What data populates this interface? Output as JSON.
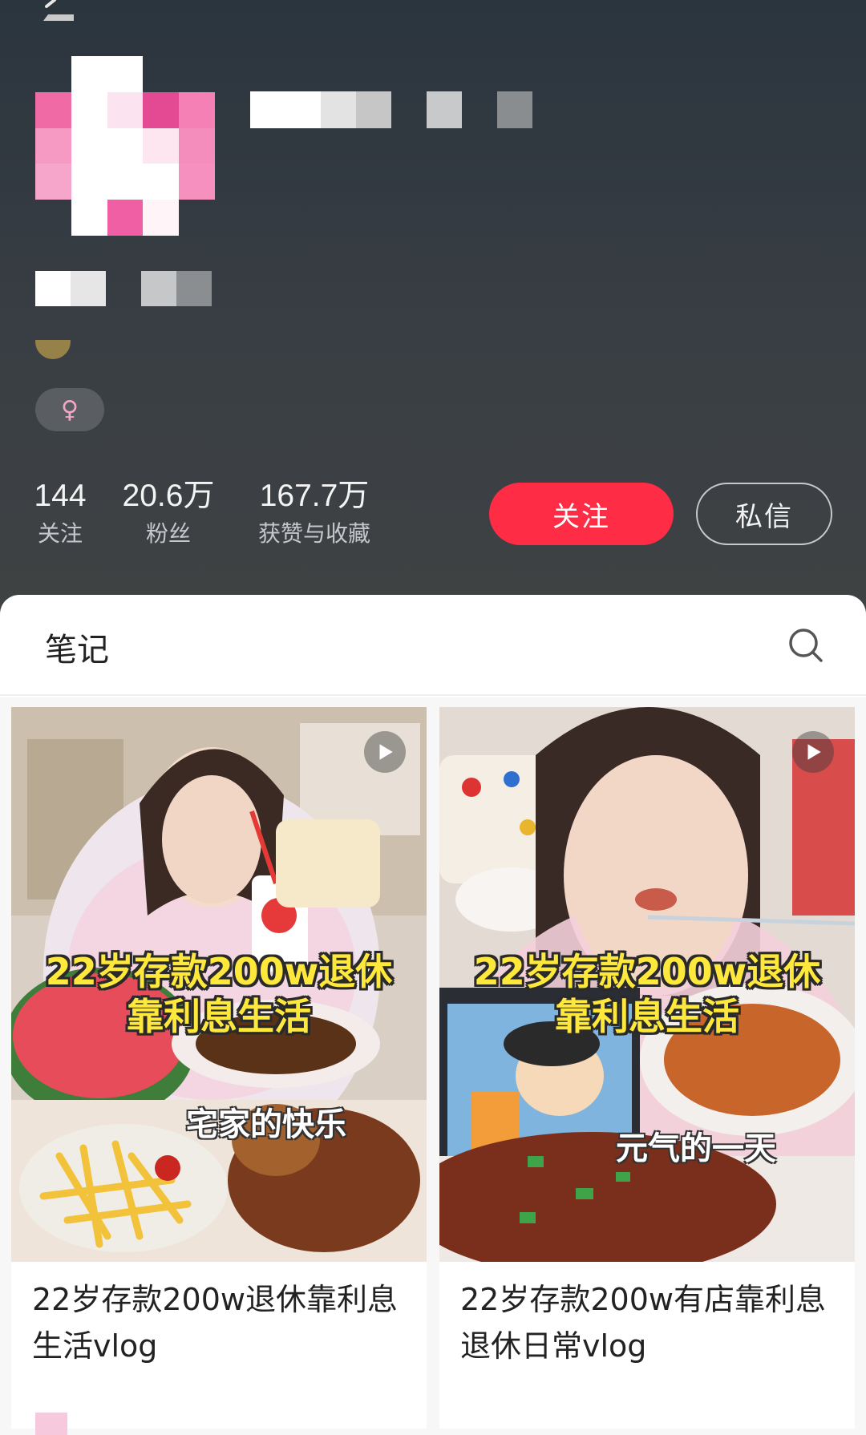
{
  "app": {
    "accent_color": "#fe2c45",
    "header_color": "#34393e",
    "back_icon": "back-chevron-icon"
  },
  "profile": {
    "gender_symbol": "♀",
    "stats": [
      {
        "value": "144",
        "label": "关注"
      },
      {
        "value": "20.6万",
        "label": "粉丝"
      },
      {
        "value": "167.7万",
        "label": "获赞与收藏"
      }
    ],
    "follow_label": "关注",
    "message_label": "私信"
  },
  "tabs": {
    "notes_label": "笔记",
    "search_icon": "search-icon"
  },
  "notes": [
    {
      "cover_title_line1": "22岁存款200w退休",
      "cover_title_line2": "靠利息生活",
      "cover_subtitle": "宅家的快乐",
      "title": "22岁存款200w退休靠利息生活vlog",
      "type_icon": "play-icon"
    },
    {
      "cover_title_line1": "22岁存款200w退休",
      "cover_title_line2": "靠利息生活",
      "cover_subtitle": "元气的一天",
      "title": "22岁存款200w有店靠利息退休日常vlog",
      "type_icon": "play-icon"
    }
  ]
}
